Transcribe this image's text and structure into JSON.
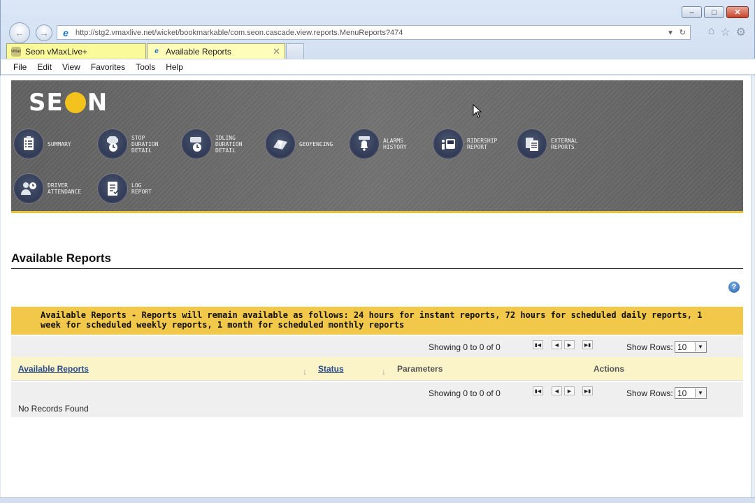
{
  "browser": {
    "url": "http://stg2.vmaxlive.net/wicket/bookmarkable/com.seon.cascade.view.reports.MenuReports?474",
    "tabs": [
      {
        "label": "Seon vMaxLive+",
        "icon_text": "vMax"
      },
      {
        "label": "Available Reports"
      }
    ],
    "menu": [
      "File",
      "Edit",
      "View",
      "Favorites",
      "Tools",
      "Help"
    ]
  },
  "header": {
    "logo_left": "SE",
    "logo_right": "N"
  },
  "reports_menu": [
    {
      "label": "SUMMARY",
      "icon": "clipboard-checklist-icon"
    },
    {
      "label": "STOP\nDURATION\nDETAIL",
      "icon": "stop-clock-icon"
    },
    {
      "label": "IDLING\nDURATION\nDETAIL",
      "icon": "bus-clock-icon"
    },
    {
      "label": "GEOFENCING",
      "icon": "map-pin-icon"
    },
    {
      "label": "ALARMS\nHISTORY",
      "icon": "bell-icon"
    },
    {
      "label": "RIDERSHIP\nREPORT",
      "icon": "rider-bus-icon"
    },
    {
      "label": "EXTERNAL\nREPORTS",
      "icon": "documents-icon"
    },
    {
      "label": "DRIVER\nATTENDANCE",
      "icon": "driver-clock-icon"
    },
    {
      "label": "LOG\nREPORT",
      "icon": "log-document-icon"
    }
  ],
  "main": {
    "title": "Available Reports",
    "notice": "Available Reports - Reports will remain available as follows: 24 hours for instant reports, 72 hours for scheduled daily reports, 1 week for scheduled weekly reports, 1 month for scheduled monthly reports",
    "showing": "Showing 0 to 0 of 0",
    "show_rows_label": "Show Rows:",
    "rows_value": "10",
    "columns": [
      "Available Reports",
      "Status",
      "Parameters",
      "Actions"
    ],
    "empty_text": "No Records Found"
  },
  "colors": {
    "accent_yellow": "#f2c84b",
    "banner_gray": "#6b6b6b",
    "logo_yellow": "#f4c21d"
  }
}
